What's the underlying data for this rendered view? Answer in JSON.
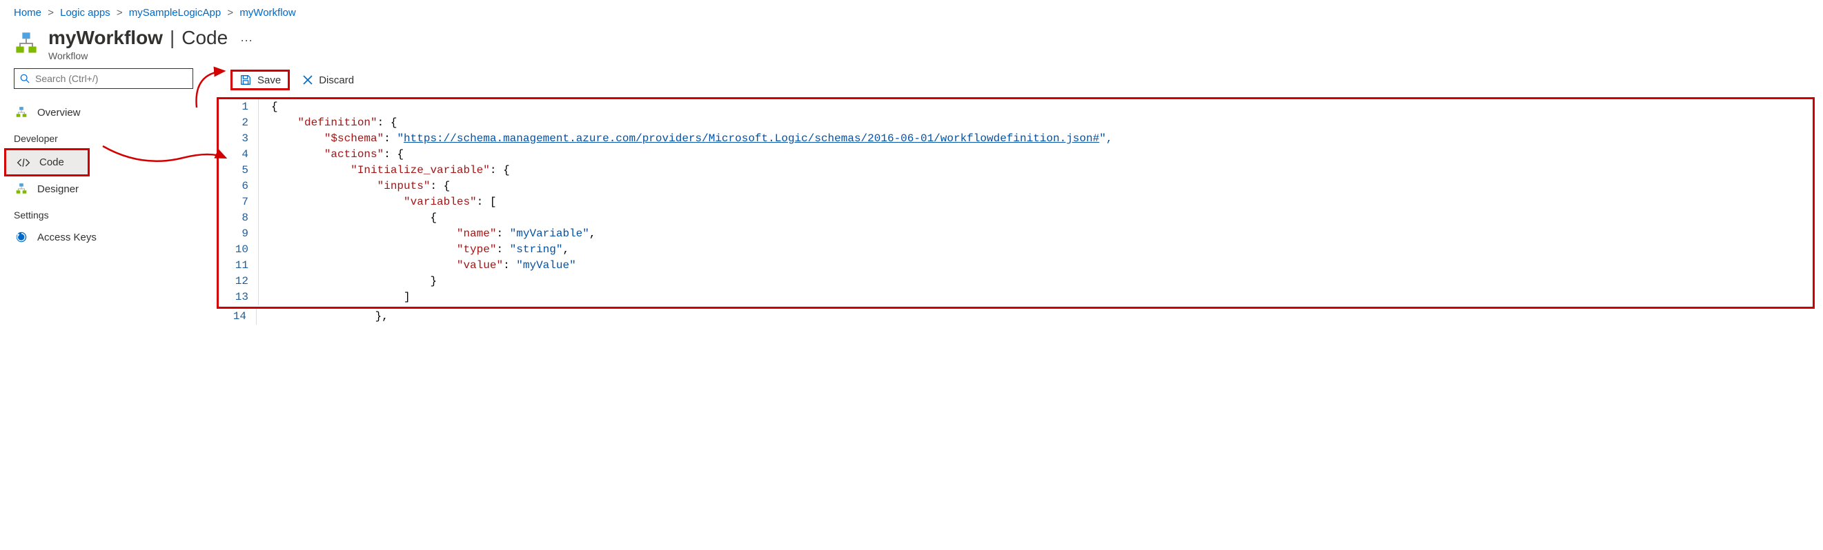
{
  "breadcrumb": {
    "items": [
      {
        "label": "Home"
      },
      {
        "label": "Logic apps"
      },
      {
        "label": "mySampleLogicApp"
      },
      {
        "label": "myWorkflow"
      }
    ],
    "sep": ">"
  },
  "header": {
    "title": "myWorkflow",
    "divider": "|",
    "section": "Code",
    "subtitle": "Workflow",
    "more": "···"
  },
  "search": {
    "placeholder": "Search (Ctrl+/)"
  },
  "nav": {
    "items": [
      {
        "label": "Overview",
        "icon": "workflow-icon"
      }
    ],
    "dev_heading": "Developer",
    "dev_items": [
      {
        "label": "Code",
        "icon": "code-icon",
        "selected": true
      },
      {
        "label": "Designer",
        "icon": "workflow-icon"
      }
    ],
    "settings_heading": "Settings",
    "settings_items": [
      {
        "label": "Access Keys",
        "icon": "refresh-icon"
      }
    ]
  },
  "toolbar": {
    "save_label": "Save",
    "discard_label": "Discard"
  },
  "code": {
    "line_count": 14,
    "lines": {
      "l1": "{",
      "l2a": "\"definition\"",
      "l2b": ": {",
      "l3a": "\"$schema\"",
      "l3b": ": ",
      "l3c": "\"",
      "l3u": "https://schema.management.azure.com/providers/Microsoft.Logic/schemas/2016-06-01/workflowdefinition.json#",
      "l3d": "\",",
      "l4a": "\"actions\"",
      "l4b": ": {",
      "l5a": "\"Initialize_variable\"",
      "l5b": ": {",
      "l6a": "\"inputs\"",
      "l6b": ": {",
      "l7a": "\"variables\"",
      "l7b": ": [",
      "l8": "{",
      "l9a": "\"name\"",
      "l9b": ": ",
      "l9c": "\"myVariable\"",
      "l9d": ",",
      "l10a": "\"type\"",
      "l10b": ": ",
      "l10c": "\"string\"",
      "l10d": ",",
      "l11a": "\"value\"",
      "l11b": ": ",
      "l11c": "\"myValue\"",
      "l12": "}",
      "l13": "]",
      "l14": "},"
    }
  }
}
